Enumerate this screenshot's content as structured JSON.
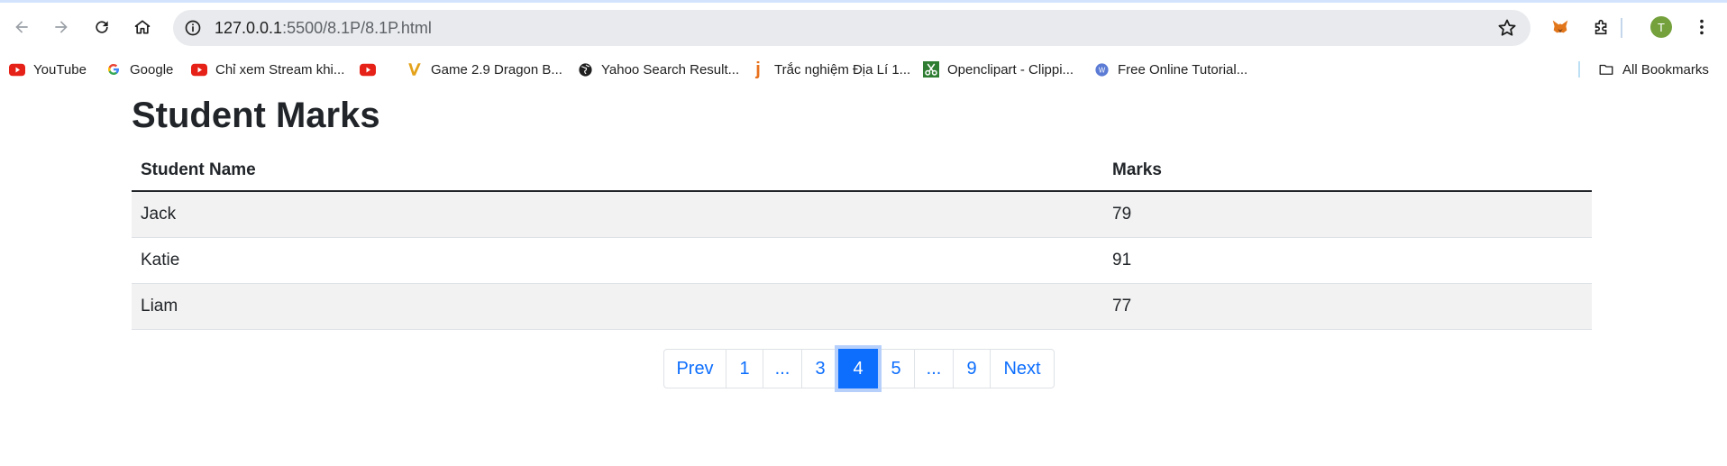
{
  "browser": {
    "url_host": "127.0.0.1",
    "url_path": ":5500/8.1P/8.1P.html",
    "profile_initial": "T",
    "colors": {
      "accent": "#d3e3fd",
      "avatar": "#74a13c",
      "omnibox": "#e8eaed"
    }
  },
  "bookmarks": [
    {
      "label": "YouTube",
      "icon": "youtube-icon"
    },
    {
      "label": "Google",
      "icon": "google-icon"
    },
    {
      "label": "Chỉ xem Stream khi...",
      "icon": "youtube-icon"
    },
    {
      "label": "",
      "icon": "youtube-icon"
    },
    {
      "label": "Game 2.9 Dragon B...",
      "icon": "vivaldi-icon"
    },
    {
      "label": "Yahoo Search Result...",
      "icon": "globe-icon"
    },
    {
      "label": "Trắc nghiệm Địa Lí 1...",
      "icon": "j-icon"
    },
    {
      "label": "Openclipart - Clippi...",
      "icon": "scissors-icon"
    },
    {
      "label": "Free Online Tutorial...",
      "icon": "w-circle-icon"
    }
  ],
  "all_bookmarks_label": "All Bookmarks",
  "page": {
    "title": "Student Marks",
    "table": {
      "headers": [
        "Student Name",
        "Marks"
      ],
      "rows": [
        {
          "name": "Jack",
          "marks": "79"
        },
        {
          "name": "Katie",
          "marks": "91"
        },
        {
          "name": "Liam",
          "marks": "77"
        }
      ]
    },
    "pagination": {
      "prev": "Prev",
      "next": "Next",
      "pages": [
        "1",
        "...",
        "3",
        "4",
        "5",
        "...",
        "9"
      ],
      "active": "4",
      "color": "#0d6efd"
    }
  }
}
